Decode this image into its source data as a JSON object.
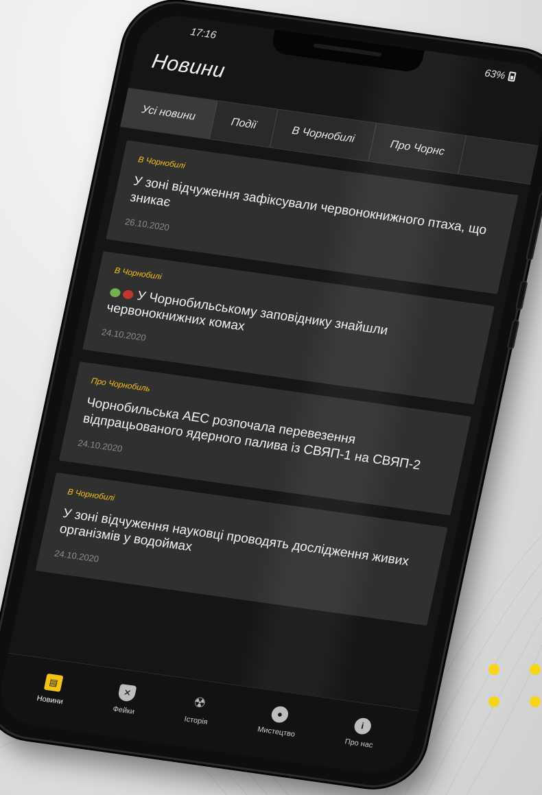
{
  "status_bar": {
    "time": "17:16",
    "battery": "63%"
  },
  "app": {
    "title": "Новини"
  },
  "tabs": [
    {
      "label": "Усі новини",
      "active": true
    },
    {
      "label": "Події",
      "active": false
    },
    {
      "label": "В Чорнобилі",
      "active": false
    },
    {
      "label": "Про Чорнс",
      "active": false
    }
  ],
  "news": [
    {
      "category": "В Чорнобилі",
      "title": "У зоні відчуження зафіксували червонокнижного птаха, що зникає",
      "date": "26.10.2020"
    },
    {
      "category": "В Чорнобилі",
      "title": "У Чорнобильському заповіднику знайшли червонокнижних комах",
      "date": "24.10.2020",
      "icons": [
        "frog-icon",
        "ladybug-icon"
      ]
    },
    {
      "category": "Про Чорнобиль",
      "title": "Чорнобильська АЕС розпочала перевезення відпрацьованого ядерного палива із СВЯП-1 на СВЯП-2",
      "date": "24.10.2020"
    },
    {
      "category": "В Чорнобилі",
      "title": "У зоні відчуження науковці проводять дослідження живих організмів у водоймах",
      "date": "24.10.2020"
    }
  ],
  "bottom_nav": [
    {
      "label": "Новини",
      "icon": "newspaper-icon",
      "active": true
    },
    {
      "label": "Фейки",
      "icon": "shield-x-icon",
      "active": false
    },
    {
      "label": "Історія",
      "icon": "radiation-icon",
      "active": false
    },
    {
      "label": "Мистецтво",
      "icon": "palette-icon",
      "active": false
    },
    {
      "label": "Про нас",
      "icon": "info-icon",
      "active": false
    }
  ],
  "colors": {
    "accent": "#f2c318",
    "background": "#151515",
    "card": "#303030"
  }
}
